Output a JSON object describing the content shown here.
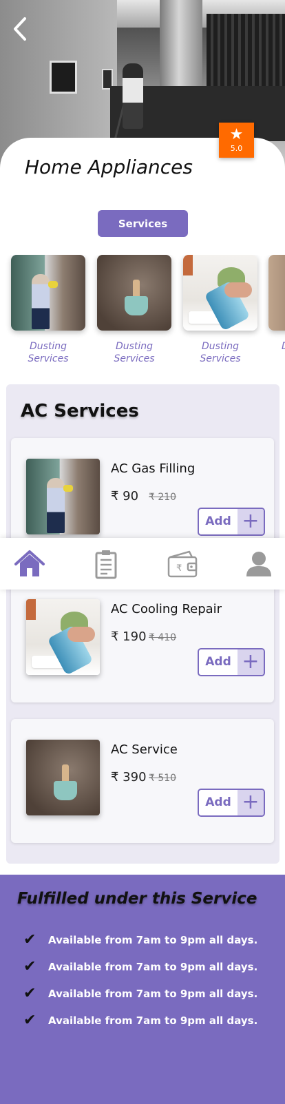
{
  "header": {
    "title": "Home Appliances",
    "rating": "5.0",
    "services_button": "Services"
  },
  "categories": [
    {
      "label": "Dusting Services"
    },
    {
      "label": "Dusting Services"
    },
    {
      "label": "Dusting Services"
    },
    {
      "label": "D S"
    }
  ],
  "ac_section": {
    "title": "AC Services",
    "items": [
      {
        "name": "AC Gas Filling",
        "price": "₹ 90",
        "old_price": "₹ 210",
        "add_label": "Add"
      },
      {
        "name": "AC Cooling Repair",
        "price": "₹ 190",
        "old_price": "₹ 410",
        "add_label": "Add"
      },
      {
        "name": "AC Service",
        "price": "₹ 390",
        "old_price": "₹ 510",
        "add_label": "Add"
      }
    ]
  },
  "footer": {
    "title": "Fulfilled under this Service",
    "points": [
      "Available from 7am to 9pm all days.",
      "Available from 7am to 9pm all days.",
      "Available from 7am to 9pm all days.",
      "Available from 7am to 9pm all days."
    ]
  },
  "navbar": {
    "items": [
      "home-icon",
      "orders-icon",
      "wallet-icon",
      "profile-icon"
    ],
    "wallet_symbol": "₹"
  },
  "colors": {
    "accent": "#7a6bbf",
    "rating_badge": "#ff6a00",
    "section_bg": "#ebe9f3"
  }
}
